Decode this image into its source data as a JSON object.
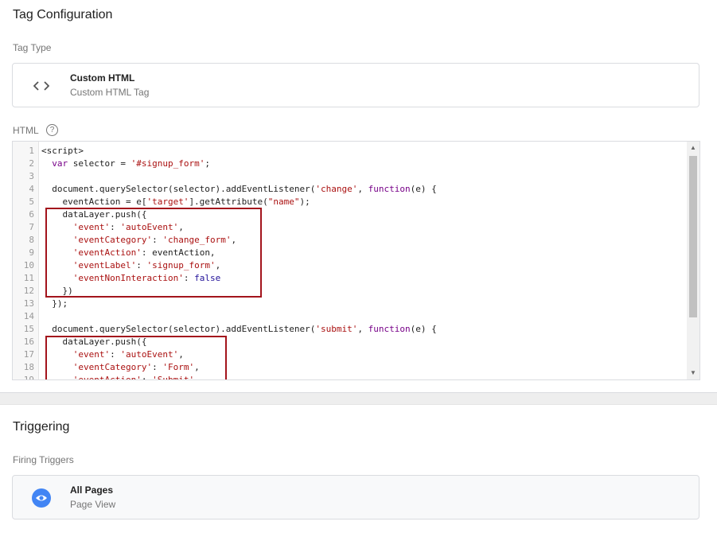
{
  "tag_configuration": {
    "title": "Tag Configuration",
    "tag_type_label": "Tag Type",
    "tag_type": {
      "name": "Custom HTML",
      "description": "Custom HTML Tag",
      "icon": "code-brackets-icon"
    },
    "html_label": "HTML",
    "help_icon_glyph": "?",
    "code_lines": [
      "<script>",
      "  var selector = '#signup_form';",
      "",
      "  document.querySelector(selector).addEventListener('change', function(e) {",
      "    eventAction = e['target'].getAttribute(\"name\");",
      "    dataLayer.push({",
      "      'event': 'autoEvent',",
      "      'eventCategory': 'change_form',",
      "      'eventAction': eventAction,",
      "      'eventLabel': 'signup_form',",
      "      'eventNonInteraction': false",
      "    })",
      "  });",
      "",
      "  document.querySelector(selector).addEventListener('submit', function(e) {",
      "    dataLayer.push({",
      "      'event': 'autoEvent',",
      "      'eventCategory': 'Form',",
      "      'eventAction': 'Submit',"
    ]
  },
  "triggering": {
    "title": "Triggering",
    "firing_label": "Firing Triggers",
    "trigger": {
      "name": "All Pages",
      "description": "Page View",
      "icon": "eye-icon"
    }
  },
  "colors": {
    "highlight_border": "#a3141c",
    "trigger_icon": "#4285f4"
  }
}
